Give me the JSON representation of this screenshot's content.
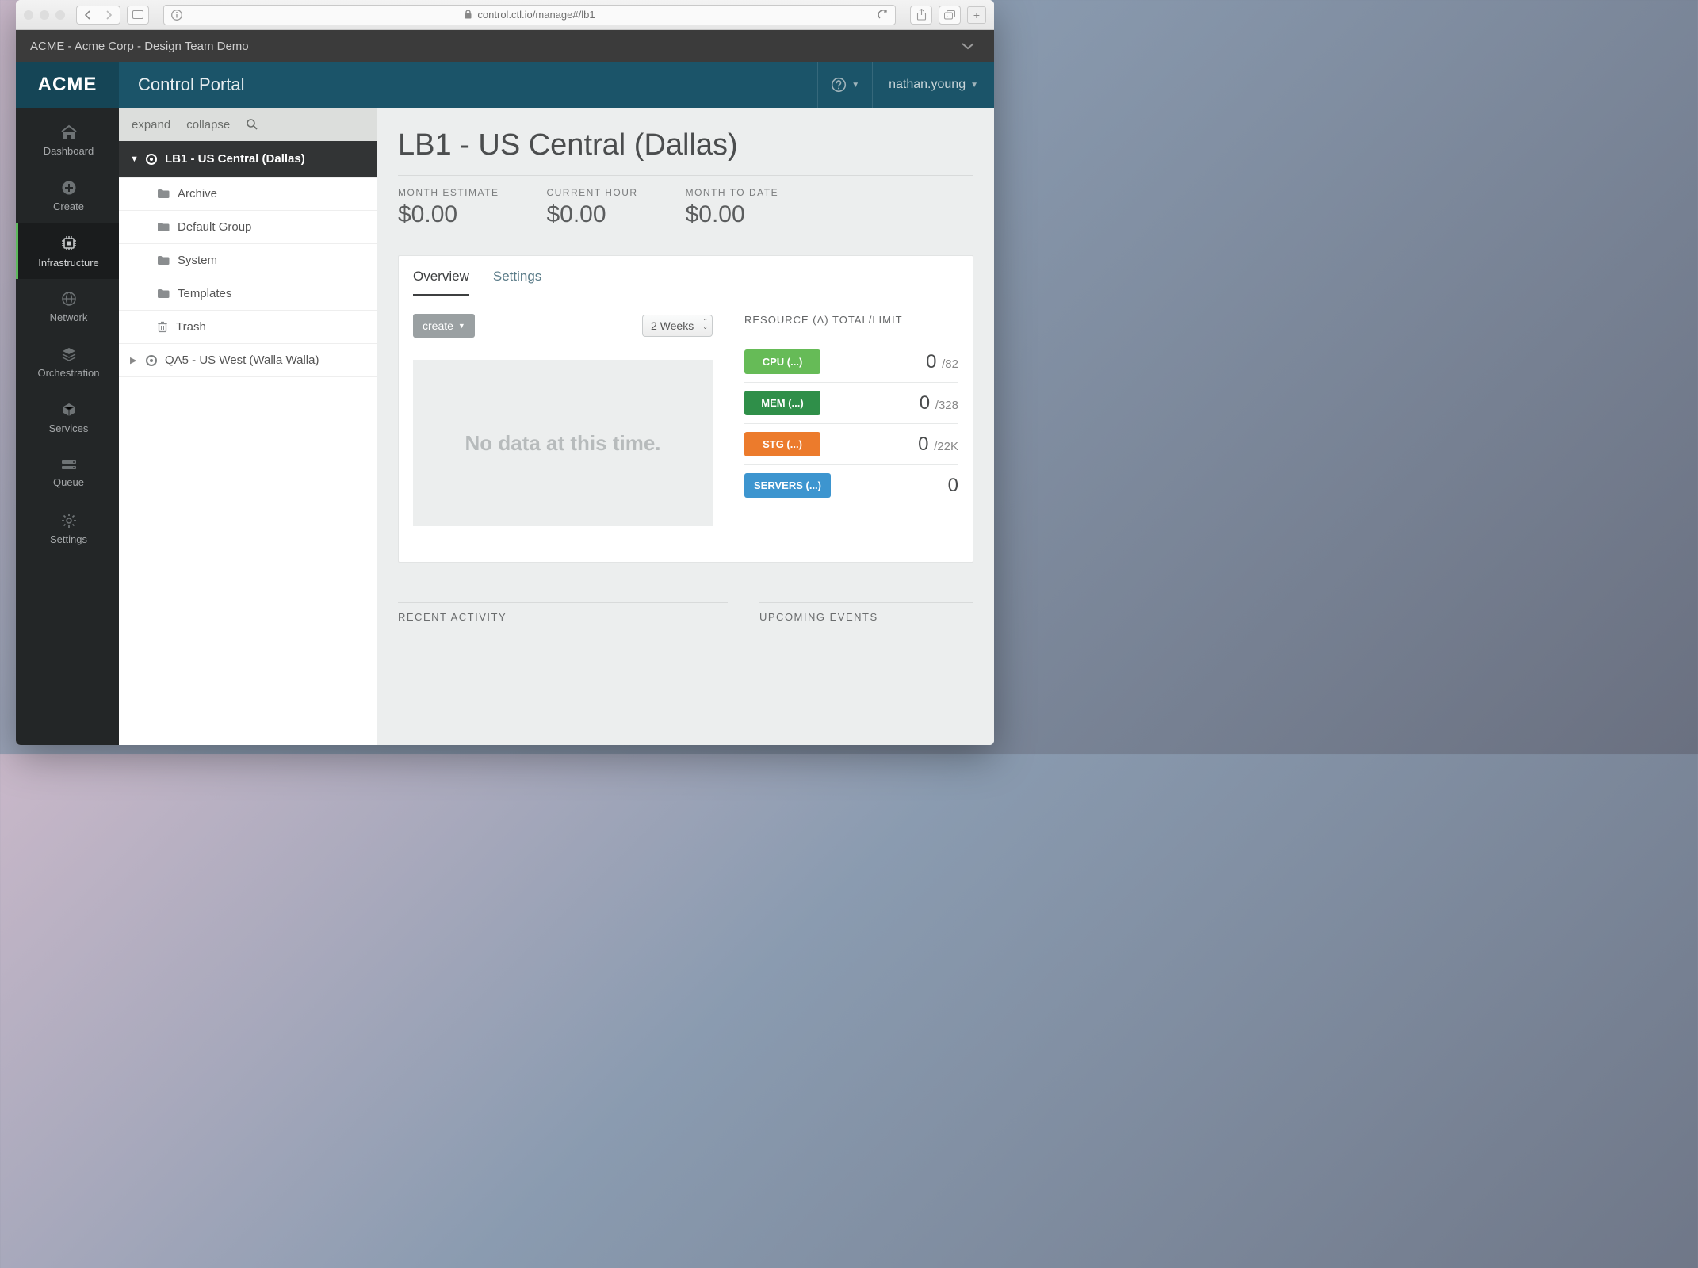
{
  "browser": {
    "url": "control.ctl.io/manage#/lb1"
  },
  "account_bar": {
    "path": "ACME - Acme Corp - Design Team Demo"
  },
  "header": {
    "logo": "ACME",
    "title": "Control Portal",
    "user": "nathan.young"
  },
  "nav": {
    "items": [
      {
        "label": "Dashboard"
      },
      {
        "label": "Create"
      },
      {
        "label": "Infrastructure"
      },
      {
        "label": "Network"
      },
      {
        "label": "Orchestration"
      },
      {
        "label": "Services"
      },
      {
        "label": "Queue"
      },
      {
        "label": "Settings"
      }
    ]
  },
  "tree": {
    "expand": "expand",
    "collapse": "collapse",
    "nodes": [
      {
        "label": "LB1 - US Central (Dallas)"
      },
      {
        "label": "Archive"
      },
      {
        "label": "Default Group"
      },
      {
        "label": "System"
      },
      {
        "label": "Templates"
      },
      {
        "label": "Trash"
      },
      {
        "label": "QA5 - US West (Walla Walla)"
      }
    ]
  },
  "page": {
    "title": "LB1 - US Central (Dallas)",
    "metrics": [
      {
        "label": "MONTH ESTIMATE",
        "value": "$0.00"
      },
      {
        "label": "CURRENT HOUR",
        "value": "$0.00"
      },
      {
        "label": "MONTH TO DATE",
        "value": "$0.00"
      }
    ],
    "tabs": {
      "overview": "Overview",
      "settings": "Settings"
    },
    "create_label": "create",
    "range_selected": "2 Weeks",
    "nodata": "No data at this time.",
    "res_header": "RESOURCE (Δ) TOTAL/LIMIT",
    "resources": [
      {
        "pill": "CPU (...)",
        "value": "0",
        "limit": "/82"
      },
      {
        "pill": "MEM (...)",
        "value": "0",
        "limit": "/328"
      },
      {
        "pill": "STG (...)",
        "value": "0",
        "limit": "/22K"
      },
      {
        "pill": "SERVERS (...)",
        "value": "0",
        "limit": ""
      }
    ],
    "recent": "RECENT ACTIVITY",
    "upcoming": "UPCOMING EVENTS"
  }
}
